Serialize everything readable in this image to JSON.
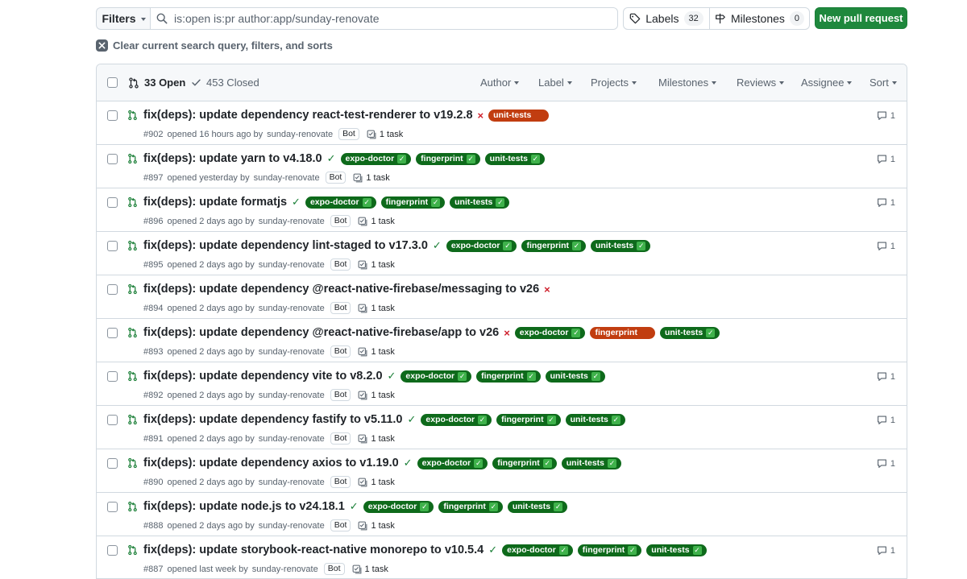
{
  "toolbar": {
    "filters_label": "Filters",
    "search_value": "is:open is:pr author:app/sunday-renovate",
    "labels_label": "Labels",
    "labels_count": "32",
    "milestones_label": "Milestones",
    "milestones_count": "0",
    "new_pr_label": "New pull request",
    "clear_label": "Clear current search query, filters, and sorts"
  },
  "list_header": {
    "open_label": "33 Open",
    "closed_label": "453 Closed",
    "filters": [
      "Author",
      "Label",
      "Projects",
      "Milestones",
      "Reviews",
      "Assignee",
      "Sort"
    ]
  },
  "colors": {
    "pass_label": "#0e6a1b",
    "fail_label": "#c13d10",
    "open_icon": "#1a7f37",
    "primary_button": "#1f883d"
  },
  "prs": [
    {
      "title": "fix(deps): update dependency react-test-renderer to v19.2.8",
      "status": "fail",
      "labels": [
        {
          "text": "unit-tests",
          "state": "fail"
        }
      ],
      "number": "#902",
      "opened": "opened 16 hours ago by",
      "author": "sunday-renovate",
      "bot": "Bot",
      "tasks": "1 task",
      "comments": "1"
    },
    {
      "title": "fix(deps): update yarn to v4.18.0",
      "status": "pass",
      "labels": [
        {
          "text": "expo-doctor",
          "state": "pass"
        },
        {
          "text": "fingerprint",
          "state": "pass"
        },
        {
          "text": "unit-tests",
          "state": "pass"
        }
      ],
      "number": "#897",
      "opened": "opened yesterday by",
      "author": "sunday-renovate",
      "bot": "Bot",
      "tasks": "1 task",
      "comments": "1"
    },
    {
      "title": "fix(deps): update formatjs",
      "status": "pass",
      "labels": [
        {
          "text": "expo-doctor",
          "state": "pass"
        },
        {
          "text": "fingerprint",
          "state": "pass"
        },
        {
          "text": "unit-tests",
          "state": "pass"
        }
      ],
      "number": "#896",
      "opened": "opened 2 days ago by",
      "author": "sunday-renovate",
      "bot": "Bot",
      "tasks": "1 task",
      "comments": "1"
    },
    {
      "title": "fix(deps): update dependency lint-staged to v17.3.0",
      "status": "pass",
      "labels": [
        {
          "text": "expo-doctor",
          "state": "pass"
        },
        {
          "text": "fingerprint",
          "state": "pass"
        },
        {
          "text": "unit-tests",
          "state": "pass"
        }
      ],
      "number": "#895",
      "opened": "opened 2 days ago by",
      "author": "sunday-renovate",
      "bot": "Bot",
      "tasks": "1 task",
      "comments": "1"
    },
    {
      "title": "fix(deps): update dependency @react-native-firebase/messaging to v26",
      "status": "fail",
      "labels": [],
      "number": "#894",
      "opened": "opened 2 days ago by",
      "author": "sunday-renovate",
      "bot": "Bot",
      "tasks": "1 task",
      "comments": ""
    },
    {
      "title": "fix(deps): update dependency @react-native-firebase/app to v26",
      "status": "fail",
      "labels": [
        {
          "text": "expo-doctor",
          "state": "pass"
        },
        {
          "text": "fingerprint",
          "state": "fail"
        },
        {
          "text": "unit-tests",
          "state": "pass"
        }
      ],
      "number": "#893",
      "opened": "opened 2 days ago by",
      "author": "sunday-renovate",
      "bot": "Bot",
      "tasks": "1 task",
      "comments": ""
    },
    {
      "title": "fix(deps): update dependency vite to v8.2.0",
      "status": "pass",
      "labels": [
        {
          "text": "expo-doctor",
          "state": "pass"
        },
        {
          "text": "fingerprint",
          "state": "pass"
        },
        {
          "text": "unit-tests",
          "state": "pass"
        }
      ],
      "number": "#892",
      "opened": "opened 2 days ago by",
      "author": "sunday-renovate",
      "bot": "Bot",
      "tasks": "1 task",
      "comments": "1"
    },
    {
      "title": "fix(deps): update dependency fastify to v5.11.0",
      "status": "pass",
      "labels": [
        {
          "text": "expo-doctor",
          "state": "pass"
        },
        {
          "text": "fingerprint",
          "state": "pass"
        },
        {
          "text": "unit-tests",
          "state": "pass"
        }
      ],
      "number": "#891",
      "opened": "opened 2 days ago by",
      "author": "sunday-renovate",
      "bot": "Bot",
      "tasks": "1 task",
      "comments": "1"
    },
    {
      "title": "fix(deps): update dependency axios to v1.19.0",
      "status": "pass",
      "labels": [
        {
          "text": "expo-doctor",
          "state": "pass"
        },
        {
          "text": "fingerprint",
          "state": "pass"
        },
        {
          "text": "unit-tests",
          "state": "pass"
        }
      ],
      "number": "#890",
      "opened": "opened 2 days ago by",
      "author": "sunday-renovate",
      "bot": "Bot",
      "tasks": "1 task",
      "comments": "1"
    },
    {
      "title": "fix(deps): update node.js to v24.18.1",
      "status": "pass",
      "labels": [
        {
          "text": "expo-doctor",
          "state": "pass"
        },
        {
          "text": "fingerprint",
          "state": "pass"
        },
        {
          "text": "unit-tests",
          "state": "pass"
        }
      ],
      "number": "#888",
      "opened": "opened 2 days ago by",
      "author": "sunday-renovate",
      "bot": "Bot",
      "tasks": "1 task",
      "comments": ""
    },
    {
      "title": "fix(deps): update storybook-react-native monorepo to v10.5.4",
      "status": "pass",
      "labels": [
        {
          "text": "expo-doctor",
          "state": "pass"
        },
        {
          "text": "fingerprint",
          "state": "pass"
        },
        {
          "text": "unit-tests",
          "state": "pass"
        }
      ],
      "number": "#887",
      "opened": "opened last week by",
      "author": "sunday-renovate",
      "bot": "Bot",
      "tasks": "1 task",
      "comments": "1"
    }
  ]
}
